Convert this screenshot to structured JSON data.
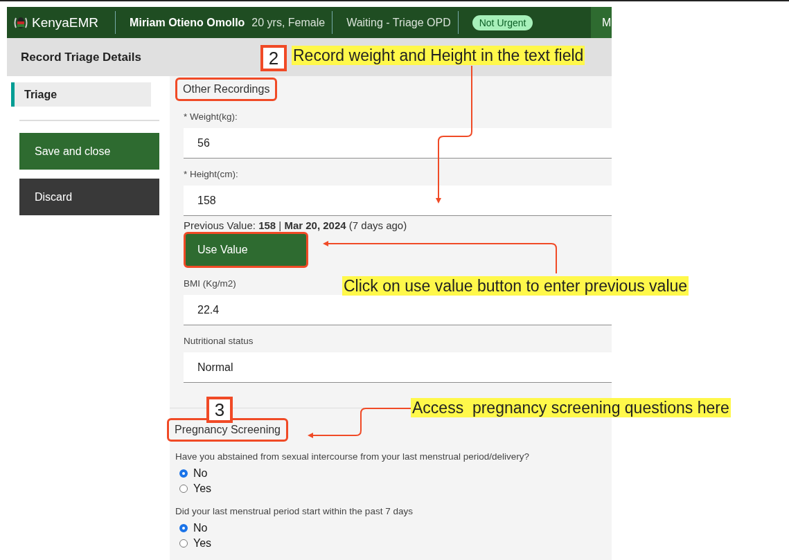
{
  "header": {
    "logo": "KenyaEMR",
    "patient_name": "Miriam Otieno Omollo",
    "patient_info": "20 yrs, Female",
    "visit_status": "Waiting - Triage OPD",
    "priority": "Not Urgent",
    "cut_button": "M"
  },
  "sidebar": {
    "title": "Record Triage Details",
    "items": [
      {
        "label": "Triage",
        "selected": true
      }
    ],
    "buttons": [
      {
        "label": "Save and close",
        "kind": "primary"
      },
      {
        "label": "Discard",
        "kind": "secondary"
      }
    ]
  },
  "form": {
    "sections": [
      {
        "title": "Other Recordings",
        "highlighted": true,
        "fields": [
          {
            "label": "* Weight(kg):",
            "value": "56"
          },
          {
            "label": "* Height(cm):",
            "value": "158",
            "previous_value": "Previous Value: **158** | **Mar 20, 2024** (7 days ago)",
            "button": {
              "label": "Use Value",
              "highlighted": true
            }
          },
          {
            "label": "BMI (Kg/m2)",
            "value": "22.4"
          },
          {
            "label": "Nutritional status",
            "value": "Normal"
          }
        ]
      },
      {
        "title": "Pregnancy Screening",
        "highlighted": true,
        "questions": [
          {
            "text": "Have you abstained from sexual intercourse from your last menstrual period/delivery?",
            "options": [
              {
                "label": "No",
                "selected": true
              },
              {
                "label": "Yes",
                "selected": false
              }
            ]
          },
          {
            "text": "Did your last menstrual period start within the past 7 days",
            "options": [
              {
                "label": "No",
                "selected": true
              },
              {
                "label": "Yes",
                "selected": false
              }
            ]
          }
        ]
      }
    ]
  },
  "annotations": [
    {
      "number": "2",
      "text": "Record weight and Height in the text field"
    },
    {
      "text": "Click on use value button to enter previous value"
    },
    {
      "number": "3",
      "text": "Access  pregnancy screening questions here"
    }
  ]
}
